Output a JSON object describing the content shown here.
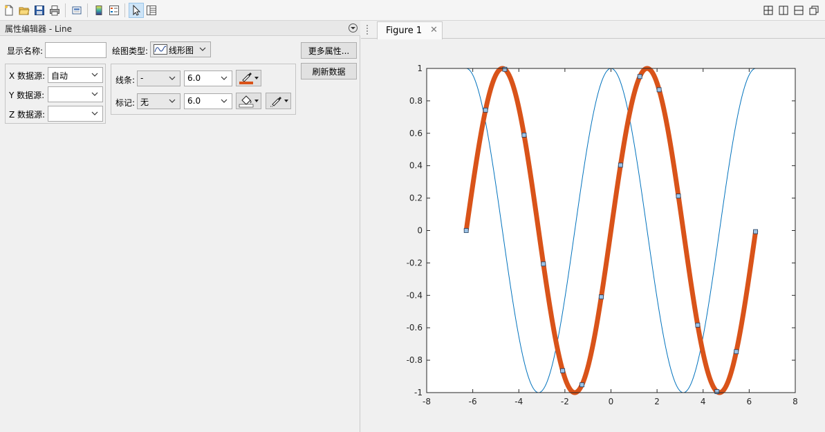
{
  "toolbar": {
    "left_icons": [
      "new-file-icon",
      "open-folder-icon",
      "save-icon",
      "print-icon",
      "print-preview-icon",
      "colorbar-icon",
      "legend-icon",
      "pointer-icon",
      "property-editor-icon"
    ],
    "right_icons": [
      "tile-grid-icon",
      "split-vertical-icon",
      "split-horizontal-icon",
      "restore-window-icon"
    ]
  },
  "property_editor": {
    "title": "属性编辑器 - Line",
    "display_name_label": "显示名称:",
    "display_name_value": "",
    "plot_type_label": "绘图类型:",
    "plot_type_value": "线形图",
    "more_props_button": "更多属性...",
    "refresh_button": "刷新数据",
    "x_source_label": "X 数据源:",
    "x_source_value": "自动",
    "y_source_label": "Y 数据源:",
    "y_source_value": "",
    "z_source_label": "Z 数据源:",
    "z_source_value": "",
    "line_label": "线条:",
    "line_style_value": "-",
    "line_width_value": "6.0",
    "marker_label": "标记:",
    "marker_value": "无",
    "marker_size_value": "6.0",
    "line_color": "#d95319"
  },
  "figure": {
    "tab_label": "Figure 1",
    "tab_close": "✕"
  },
  "chart_data": {
    "type": "line",
    "xlim": [
      -8,
      8
    ],
    "ylim": [
      -1,
      1
    ],
    "x_ticks": [
      -8,
      -6,
      -4,
      -2,
      0,
      2,
      4,
      6,
      8
    ],
    "y_ticks": [
      -1,
      -0.8,
      -0.6,
      -0.4,
      -0.2,
      0,
      0.2,
      0.4,
      0.6,
      0.8,
      1
    ],
    "x_tick_labels": [
      "-8",
      "-6",
      "-4",
      "-2",
      "0",
      "2",
      "4",
      "6",
      "8"
    ],
    "y_tick_labels": [
      "-1",
      "-0.8",
      "-0.6",
      "-0.4",
      "-0.2",
      "0",
      "0.2",
      "0.4",
      "0.6",
      "0.8",
      "1"
    ],
    "grid": false,
    "title": "",
    "xlabel": "",
    "ylabel": "",
    "series": [
      {
        "function": "cos(x)",
        "x_range": [
          -6.2832,
          6.2832
        ],
        "color": "#0072bd",
        "style": "thin line"
      },
      {
        "function": "sin(x)",
        "x_range": [
          -6.2832,
          6.2832
        ],
        "color": "#d95319",
        "style": "thick line with square markers",
        "marker_color": "#9dc3e6",
        "marker_x": [
          -6.2832,
          -5.4459,
          -4.6086,
          -3.7713,
          -2.934,
          -2.0967,
          -1.2594,
          -0.4221,
          0.4152,
          1.2525,
          2.0898,
          2.9271,
          3.7644,
          4.6017,
          5.439,
          6.2763
        ]
      }
    ]
  }
}
